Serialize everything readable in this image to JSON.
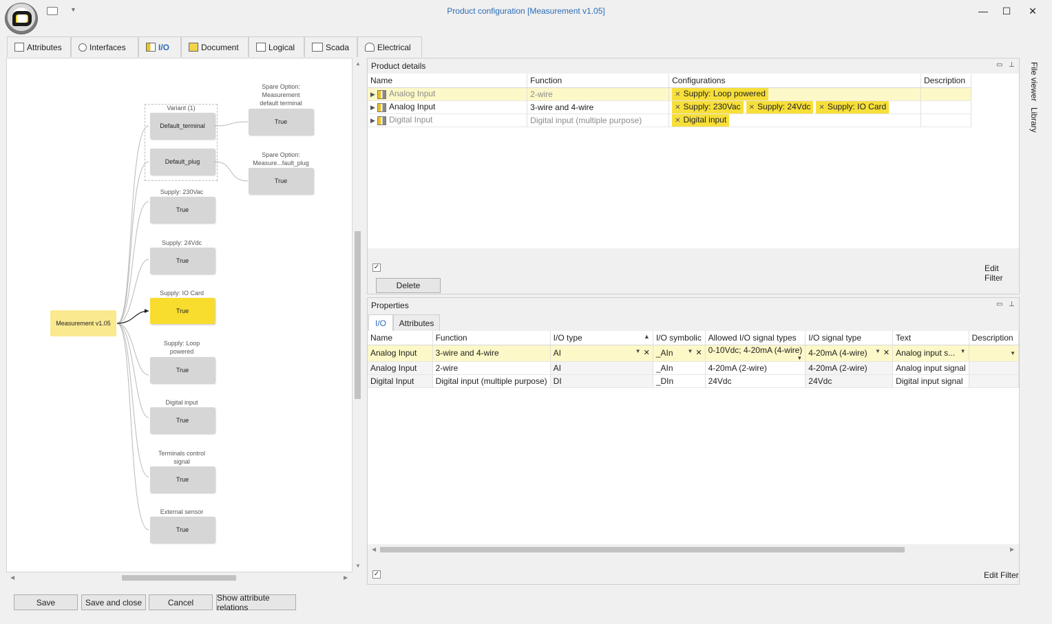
{
  "window": {
    "title": "Product configuration [Measurement v1.05]",
    "minimize": "—",
    "maximize": "☐",
    "close": "✕"
  },
  "tabs": [
    {
      "label": "Attributes",
      "icon": "attributes-icon"
    },
    {
      "label": "Interfaces",
      "icon": "interfaces-icon"
    },
    {
      "label": "I/O",
      "icon": "io-icon",
      "active": true
    },
    {
      "label": "Document",
      "icon": "document-icon"
    },
    {
      "label": "Logical",
      "icon": "logical-icon"
    },
    {
      "label": "Scada",
      "icon": "scada-icon"
    },
    {
      "label": "Electrical",
      "icon": "electrical-icon"
    }
  ],
  "graph": {
    "root": "Measurement v1.05",
    "variant_label": "Variant (1)",
    "variant_nodes": [
      "Default_terminal",
      "Default_plug"
    ],
    "spare1_label": "Spare Option: Measurement default terminal",
    "spare1_label_lines": [
      "Spare Option:",
      "Measurement",
      "default terminal"
    ],
    "spare1_value": "True",
    "spare2_label_lines": [
      "Spare Option:",
      "Measure...fault_plug"
    ],
    "spare2_value": "True",
    "options": [
      {
        "label_lines": [
          "Supply: 230Vac"
        ],
        "value": "True"
      },
      {
        "label_lines": [
          "Supply: 24Vdc"
        ],
        "value": "True"
      },
      {
        "label_lines": [
          "Supply: IO Card"
        ],
        "value": "True",
        "highlight": true
      },
      {
        "label_lines": [
          "Supply: Loop",
          "powered"
        ],
        "value": "True"
      },
      {
        "label_lines": [
          "Digital input"
        ],
        "value": "True"
      },
      {
        "label_lines": [
          "Terminals control",
          "signal"
        ],
        "value": "True"
      },
      {
        "label_lines": [
          "External sensor"
        ],
        "value": "True"
      }
    ]
  },
  "product_details": {
    "title": "Product details",
    "columns": [
      "Name",
      "Function",
      "Configurations",
      "Description"
    ],
    "rows": [
      {
        "name": "Analog Input",
        "function": "2-wire",
        "configs": [
          "Supply: Loop powered"
        ],
        "description": "",
        "style": "sel-grey"
      },
      {
        "name": "Analog Input",
        "function": "3-wire and 4-wire",
        "configs": [
          "Supply: 230Vac",
          "Supply: 24Vdc",
          "Supply: IO Card"
        ],
        "description": "",
        "style": "normal"
      },
      {
        "name": "Digital Input",
        "function": "Digital input (multiple purpose)",
        "configs": [
          "Digital input"
        ],
        "description": "",
        "style": "grey"
      }
    ],
    "delete_label": "Delete",
    "edit_filter": "Edit Filter"
  },
  "properties": {
    "title": "Properties",
    "tabs": [
      "I/O",
      "Attributes"
    ],
    "columns": [
      "Name",
      "Function",
      "I/O type",
      "I/O symbolic",
      "Allowed I/O signal types",
      "I/O signal type",
      "Text",
      "Description"
    ],
    "rows": [
      {
        "name": "Analog Input",
        "function": "3-wire and 4-wire",
        "io_type": "AI",
        "symbolic": "_AIn",
        "allowed": "0-10Vdc; 4-20mA (4-wire)",
        "signal": "4-20mA (4-wire)",
        "text": "Analog input s...",
        "description": ""
      },
      {
        "name": "Analog Input",
        "function": "2-wire",
        "io_type": "AI",
        "symbolic": "_AIn",
        "allowed": "4-20mA (2-wire)",
        "signal": "4-20mA (2-wire)",
        "text": "Analog input signal",
        "description": ""
      },
      {
        "name": "Digital Input",
        "function": "Digital input (multiple purpose)",
        "io_type": "DI",
        "symbolic": "_DIn",
        "allowed": "24Vdc",
        "signal": "24Vdc",
        "text": "Digital input signal",
        "description": ""
      }
    ],
    "edit_filter": "Edit Filter"
  },
  "side_panels": [
    "File viewer",
    "Library"
  ],
  "footer": {
    "save": "Save",
    "save_close": "Save and close",
    "cancel": "Cancel",
    "show_relations": "Show attribute relations"
  },
  "colors": {
    "accent": "#2b6cb8",
    "highlight": "#f8dc2e",
    "chip": "#f7df3a",
    "node": "#d6d6d6"
  }
}
